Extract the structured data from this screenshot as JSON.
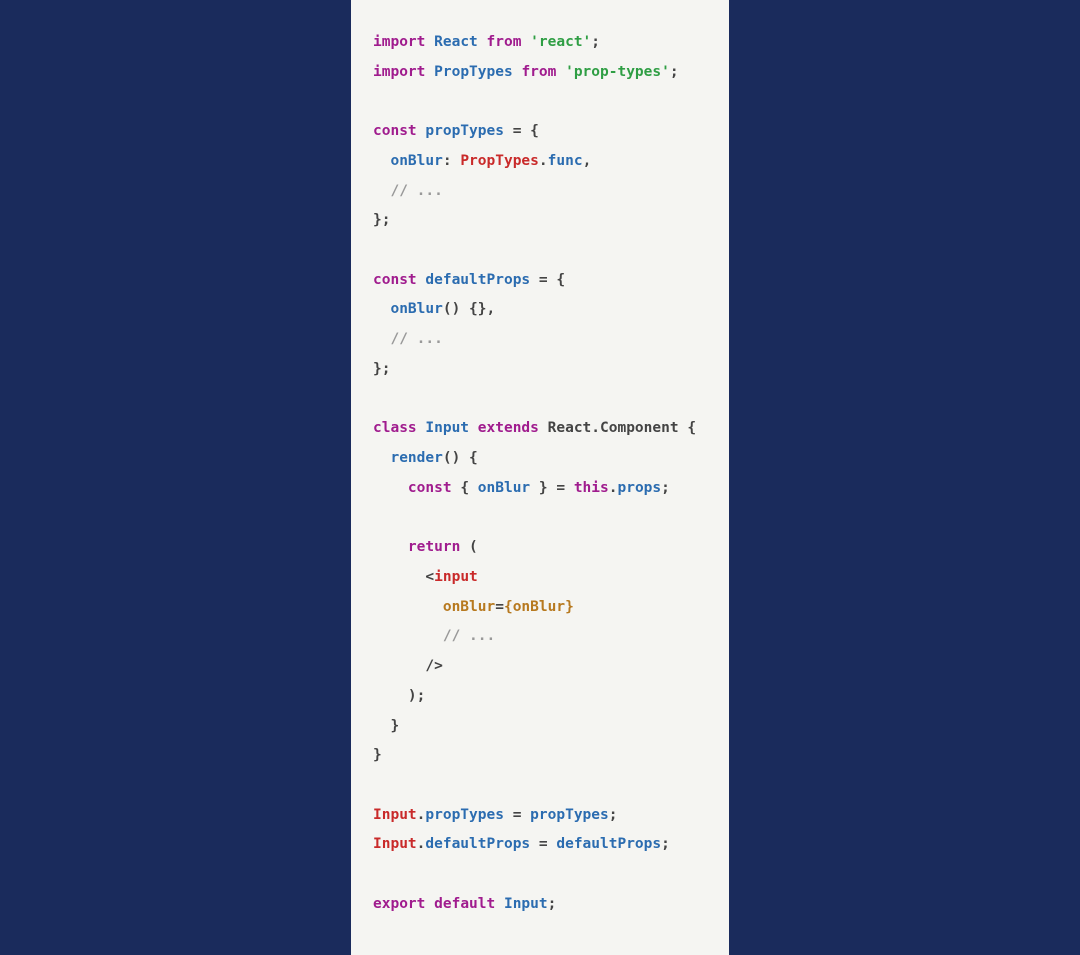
{
  "code": {
    "lines": [
      {
        "tokens": [
          {
            "cls": "t-keyword",
            "txt": "import"
          },
          {
            "cls": "t-default",
            "txt": " "
          },
          {
            "cls": "t-class",
            "txt": "React"
          },
          {
            "cls": "t-default",
            "txt": " "
          },
          {
            "cls": "t-keyword",
            "txt": "from"
          },
          {
            "cls": "t-default",
            "txt": " "
          },
          {
            "cls": "t-string",
            "txt": "'react'"
          },
          {
            "cls": "t-punct",
            "txt": ";"
          }
        ]
      },
      {
        "tokens": [
          {
            "cls": "t-keyword",
            "txt": "import"
          },
          {
            "cls": "t-default",
            "txt": " "
          },
          {
            "cls": "t-class",
            "txt": "PropTypes"
          },
          {
            "cls": "t-default",
            "txt": " "
          },
          {
            "cls": "t-keyword",
            "txt": "from"
          },
          {
            "cls": "t-default",
            "txt": " "
          },
          {
            "cls": "t-string",
            "txt": "'prop-types'"
          },
          {
            "cls": "t-punct",
            "txt": ";"
          }
        ]
      },
      {
        "tokens": [
          {
            "cls": "t-default",
            "txt": ""
          }
        ]
      },
      {
        "tokens": [
          {
            "cls": "t-keyword",
            "txt": "const"
          },
          {
            "cls": "t-default",
            "txt": " "
          },
          {
            "cls": "t-class",
            "txt": "propTypes"
          },
          {
            "cls": "t-default",
            "txt": " = "
          },
          {
            "cls": "t-punct",
            "txt": "{"
          }
        ]
      },
      {
        "tokens": [
          {
            "cls": "t-default",
            "txt": "  "
          },
          {
            "cls": "t-prop",
            "txt": "onBlur"
          },
          {
            "cls": "t-punct",
            "txt": ": "
          },
          {
            "cls": "t-ident",
            "txt": "PropTypes"
          },
          {
            "cls": "t-punct",
            "txt": "."
          },
          {
            "cls": "t-class",
            "txt": "func"
          },
          {
            "cls": "t-punct",
            "txt": ","
          }
        ]
      },
      {
        "tokens": [
          {
            "cls": "t-default",
            "txt": "  "
          },
          {
            "cls": "t-comment",
            "txt": "// ..."
          }
        ]
      },
      {
        "tokens": [
          {
            "cls": "t-punct",
            "txt": "};"
          }
        ]
      },
      {
        "tokens": [
          {
            "cls": "t-default",
            "txt": ""
          }
        ]
      },
      {
        "tokens": [
          {
            "cls": "t-keyword",
            "txt": "const"
          },
          {
            "cls": "t-default",
            "txt": " "
          },
          {
            "cls": "t-class",
            "txt": "defaultProps"
          },
          {
            "cls": "t-default",
            "txt": " = "
          },
          {
            "cls": "t-punct",
            "txt": "{"
          }
        ]
      },
      {
        "tokens": [
          {
            "cls": "t-default",
            "txt": "  "
          },
          {
            "cls": "t-prop",
            "txt": "onBlur"
          },
          {
            "cls": "t-punct",
            "txt": "() {},"
          }
        ]
      },
      {
        "tokens": [
          {
            "cls": "t-default",
            "txt": "  "
          },
          {
            "cls": "t-comment",
            "txt": "// ..."
          }
        ]
      },
      {
        "tokens": [
          {
            "cls": "t-punct",
            "txt": "};"
          }
        ]
      },
      {
        "tokens": [
          {
            "cls": "t-default",
            "txt": ""
          }
        ]
      },
      {
        "tokens": [
          {
            "cls": "t-keyword",
            "txt": "class"
          },
          {
            "cls": "t-default",
            "txt": " "
          },
          {
            "cls": "t-class",
            "txt": "Input"
          },
          {
            "cls": "t-default",
            "txt": " "
          },
          {
            "cls": "t-keyword",
            "txt": "extends"
          },
          {
            "cls": "t-default",
            "txt": " "
          },
          {
            "cls": "t-obj",
            "txt": "React.Component"
          },
          {
            "cls": "t-default",
            "txt": " "
          },
          {
            "cls": "t-punct",
            "txt": "{"
          }
        ]
      },
      {
        "tokens": [
          {
            "cls": "t-default",
            "txt": "  "
          },
          {
            "cls": "t-prop",
            "txt": "render"
          },
          {
            "cls": "t-punct",
            "txt": "() {"
          }
        ]
      },
      {
        "tokens": [
          {
            "cls": "t-default",
            "txt": "    "
          },
          {
            "cls": "t-keyword",
            "txt": "const"
          },
          {
            "cls": "t-default",
            "txt": " "
          },
          {
            "cls": "t-punct",
            "txt": "{ "
          },
          {
            "cls": "t-prop",
            "txt": "onBlur"
          },
          {
            "cls": "t-punct",
            "txt": " } = "
          },
          {
            "cls": "t-this",
            "txt": "this"
          },
          {
            "cls": "t-punct",
            "txt": "."
          },
          {
            "cls": "t-class",
            "txt": "props"
          },
          {
            "cls": "t-punct",
            "txt": ";"
          }
        ]
      },
      {
        "tokens": [
          {
            "cls": "t-default",
            "txt": ""
          }
        ]
      },
      {
        "tokens": [
          {
            "cls": "t-default",
            "txt": "    "
          },
          {
            "cls": "t-keyword",
            "txt": "return"
          },
          {
            "cls": "t-default",
            "txt": " ("
          }
        ]
      },
      {
        "tokens": [
          {
            "cls": "t-default",
            "txt": "      "
          },
          {
            "cls": "t-punct",
            "txt": "<"
          },
          {
            "cls": "t-tag",
            "txt": "input"
          }
        ]
      },
      {
        "tokens": [
          {
            "cls": "t-default",
            "txt": "        "
          },
          {
            "cls": "t-attr",
            "txt": "onBlur"
          },
          {
            "cls": "t-punct",
            "txt": "="
          },
          {
            "cls": "t-brace",
            "txt": "{"
          },
          {
            "cls": "t-attr",
            "txt": "onBlur"
          },
          {
            "cls": "t-brace",
            "txt": "}"
          }
        ]
      },
      {
        "tokens": [
          {
            "cls": "t-default",
            "txt": "        "
          },
          {
            "cls": "t-comment",
            "txt": "// ..."
          }
        ]
      },
      {
        "tokens": [
          {
            "cls": "t-default",
            "txt": "      "
          },
          {
            "cls": "t-punct",
            "txt": "/>"
          }
        ]
      },
      {
        "tokens": [
          {
            "cls": "t-default",
            "txt": "    "
          },
          {
            "cls": "t-punct",
            "txt": ");"
          }
        ]
      },
      {
        "tokens": [
          {
            "cls": "t-default",
            "txt": "  "
          },
          {
            "cls": "t-punct",
            "txt": "}"
          }
        ]
      },
      {
        "tokens": [
          {
            "cls": "t-punct",
            "txt": "}"
          }
        ]
      },
      {
        "tokens": [
          {
            "cls": "t-default",
            "txt": ""
          }
        ]
      },
      {
        "tokens": [
          {
            "cls": "t-ident",
            "txt": "Input"
          },
          {
            "cls": "t-punct",
            "txt": "."
          },
          {
            "cls": "t-class",
            "txt": "propTypes"
          },
          {
            "cls": "t-default",
            "txt": " = "
          },
          {
            "cls": "t-class",
            "txt": "propTypes"
          },
          {
            "cls": "t-punct",
            "txt": ";"
          }
        ]
      },
      {
        "tokens": [
          {
            "cls": "t-ident",
            "txt": "Input"
          },
          {
            "cls": "t-punct",
            "txt": "."
          },
          {
            "cls": "t-class",
            "txt": "defaultProps"
          },
          {
            "cls": "t-default",
            "txt": " = "
          },
          {
            "cls": "t-class",
            "txt": "defaultProps"
          },
          {
            "cls": "t-punct",
            "txt": ";"
          }
        ]
      },
      {
        "tokens": [
          {
            "cls": "t-default",
            "txt": ""
          }
        ]
      },
      {
        "tokens": [
          {
            "cls": "t-keyword",
            "txt": "export"
          },
          {
            "cls": "t-default",
            "txt": " "
          },
          {
            "cls": "t-keyword",
            "txt": "default"
          },
          {
            "cls": "t-default",
            "txt": " "
          },
          {
            "cls": "t-class",
            "txt": "Input"
          },
          {
            "cls": "t-punct",
            "txt": ";"
          }
        ]
      }
    ]
  }
}
